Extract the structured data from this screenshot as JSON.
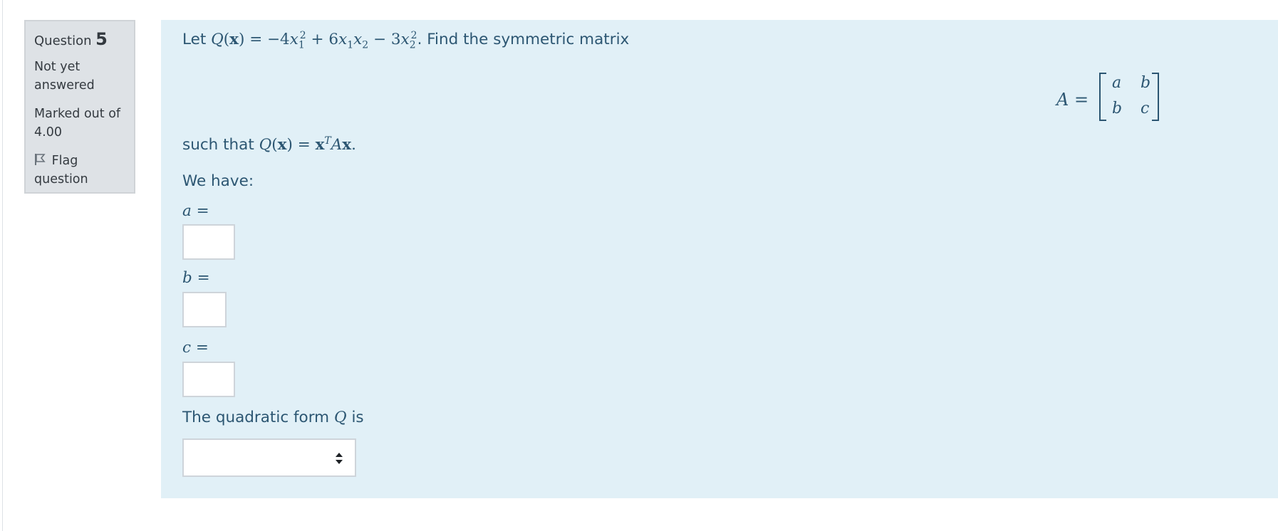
{
  "info": {
    "question_word": "Question",
    "question_number": "5",
    "state": "Not yet answered",
    "grade": "Marked out of 4.00",
    "flag_label": "Flag question"
  },
  "question": {
    "intro_text": "Let",
    "intro_suffix": ". Find the symmetric matrix",
    "such_that_text": "such that",
    "we_have": "We have:",
    "quadratic_form_text": "The quadratic form",
    "quadratic_form_suffix": "is"
  },
  "matrix": {
    "lhs": "A =",
    "cells": [
      "a",
      "b",
      "b",
      "c"
    ]
  },
  "answers": {
    "a_label": "a =",
    "b_label": "b =",
    "c_label": "c =",
    "a_value": "",
    "b_value": "",
    "c_value": "",
    "form_selected": ""
  },
  "colors": {
    "formulation_bg": "#e1f0f7",
    "formulation_text": "#2c5672",
    "info_bg": "#dee2e6"
  }
}
